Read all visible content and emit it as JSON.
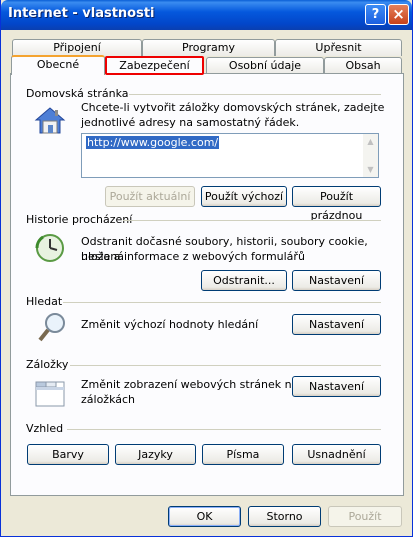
{
  "window": {
    "title": "Internet - vlastnosti",
    "help": "?",
    "close": "×"
  },
  "tabs": {
    "row_back": [
      "Připojení",
      "Programy",
      "Upřesnit"
    ],
    "row_front": [
      "Obecné",
      "Zabezpečení",
      "Osobní údaje",
      "Obsah"
    ]
  },
  "home": {
    "heading": "Domovská stránka",
    "desc_1": "Chcete-li vytvořit záložky domovských stránek, zadejte",
    "desc_2": "jednotlivé adresy na samostatný řádek.",
    "url": "http://www.google.com/",
    "btn_current": "Použít aktuální",
    "btn_default": "Použít výchozí",
    "btn_blank": "Použít prázdnou"
  },
  "history": {
    "heading": "Historie procházení",
    "desc_1": "Odstranit dočasné soubory, historii, soubory cookie, uložená",
    "desc_2": "hesla a informace z webových formulářů",
    "btn_delete": "Odstranit...",
    "btn_settings": "Nastavení"
  },
  "search": {
    "heading": "Hledat",
    "desc": "Změnit výchozí hodnoty hledání",
    "btn_settings": "Nastavení"
  },
  "tabs_section": {
    "heading": "Záložky",
    "desc_1": "Změnit zobrazení webových stránek na",
    "desc_2": "záložkách",
    "btn_settings": "Nastavení"
  },
  "appearance": {
    "heading": "Vzhled",
    "btn_colors": "Barvy",
    "btn_languages": "Jazyky",
    "btn_fonts": "Písma",
    "btn_access": "Usnadnění"
  },
  "footer": {
    "ok": "OK",
    "cancel": "Storno",
    "apply": "Použít"
  },
  "colors": {
    "highlight_border": "#e00000",
    "title_bar": "#0246c9"
  }
}
